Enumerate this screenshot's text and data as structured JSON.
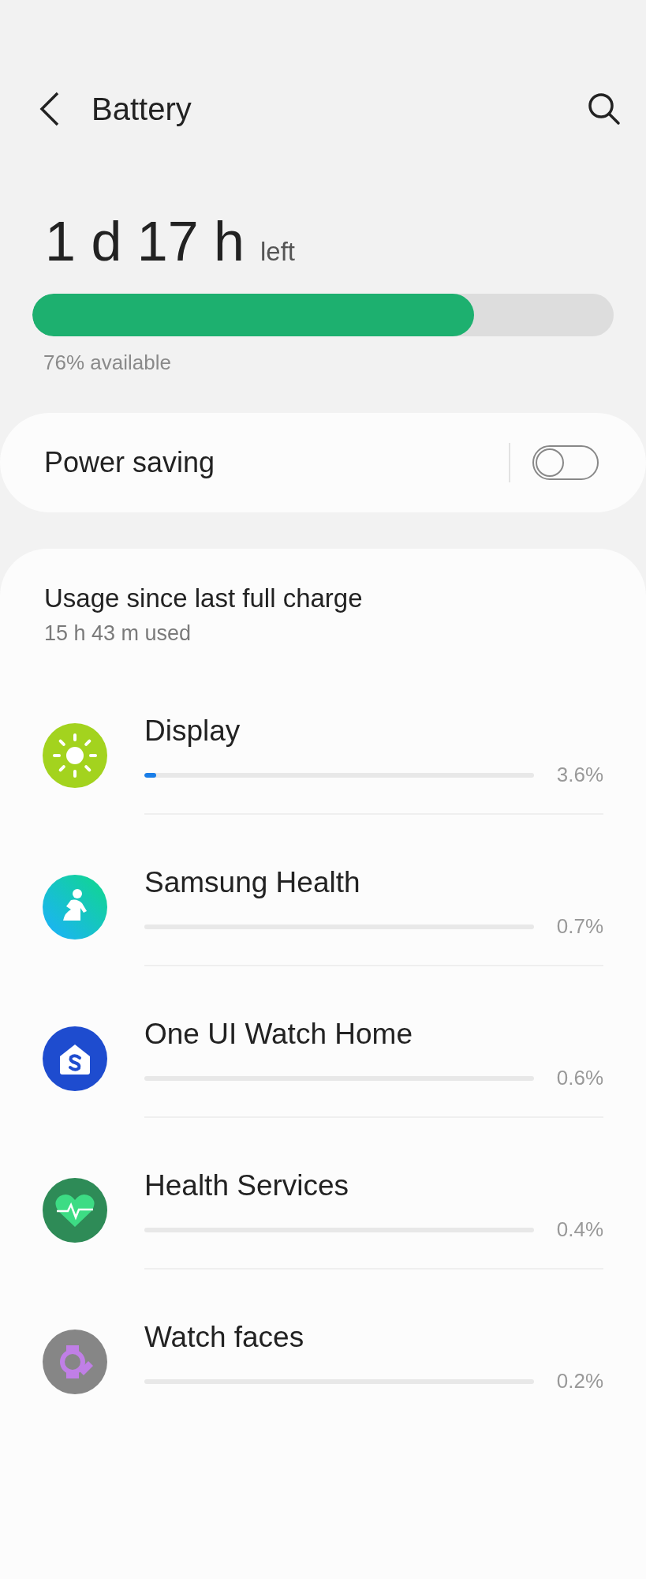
{
  "header": {
    "title": "Battery"
  },
  "battery": {
    "time": "1 d 17 h",
    "suffix": "left",
    "level": 0.76,
    "available": "76% available"
  },
  "power_saving": {
    "label": "Power saving",
    "on": false
  },
  "usage": {
    "title": "Usage since last full charge",
    "subtitle": "15 h 43 m used",
    "items": [
      {
        "kind": "display",
        "name": "Display",
        "level": 0.03,
        "percent": "3.6%"
      },
      {
        "kind": "health",
        "name": "Samsung Health",
        "percent": "0.7%"
      },
      {
        "kind": "home",
        "name": "One UI Watch Home",
        "percent": "0.6%"
      },
      {
        "kind": "services",
        "name": "Health Services",
        "percent": "0.4%"
      },
      {
        "kind": "faces",
        "name": "Watch faces",
        "percent": "0.2%"
      }
    ]
  }
}
